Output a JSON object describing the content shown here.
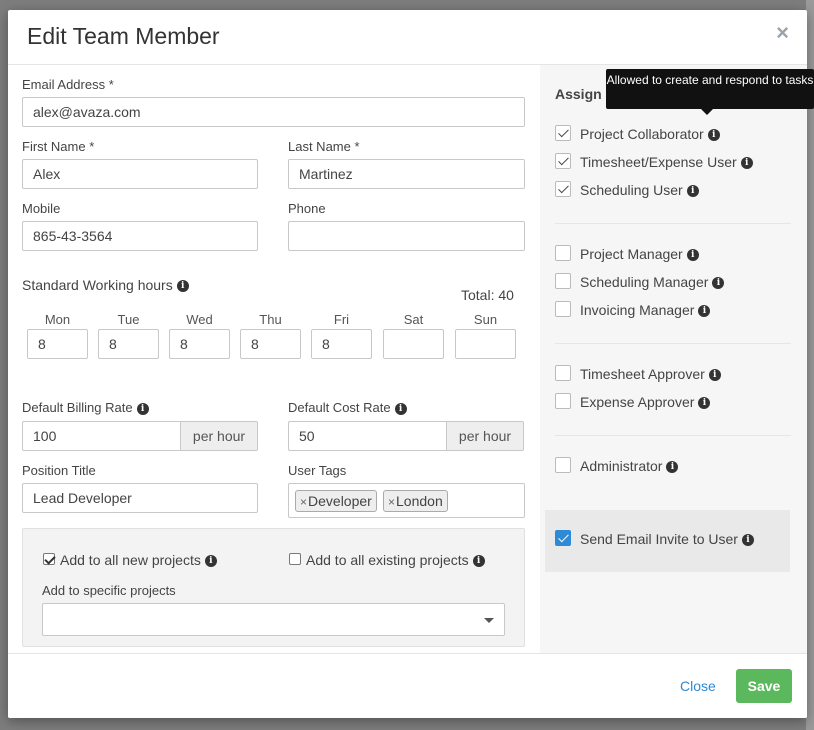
{
  "modal": {
    "title": "Edit Team Member",
    "close_icon": "×"
  },
  "form": {
    "email": {
      "label": "Email Address",
      "required": "*",
      "value": "alex@avaza.com"
    },
    "first_name": {
      "label": "First Name",
      "required": "*",
      "value": "Alex"
    },
    "last_name": {
      "label": "Last Name",
      "required": "*",
      "value": "Martinez"
    },
    "mobile": {
      "label": "Mobile",
      "value": "865-43-3564"
    },
    "phone": {
      "label": "Phone",
      "value": ""
    },
    "working_hours": {
      "label": "Standard Working hours",
      "total": "Total: 40",
      "days": [
        {
          "name": "Mon",
          "value": "8"
        },
        {
          "name": "Tue",
          "value": "8"
        },
        {
          "name": "Wed",
          "value": "8"
        },
        {
          "name": "Thu",
          "value": "8"
        },
        {
          "name": "Fri",
          "value": "8"
        },
        {
          "name": "Sat",
          "value": ""
        },
        {
          "name": "Sun",
          "value": ""
        }
      ]
    },
    "billing_rate": {
      "label": "Default Billing Rate",
      "value": "100",
      "unit": "per hour"
    },
    "cost_rate": {
      "label": "Default Cost Rate",
      "value": "50",
      "unit": "per hour"
    },
    "position_title": {
      "label": "Position Title",
      "value": "Lead Developer"
    },
    "user_tags": {
      "label": "User Tags",
      "remove_glyph": "×",
      "tags": [
        "Developer",
        "London"
      ]
    },
    "projects": {
      "add_new": {
        "label": "Add to all new projects",
        "checked": true
      },
      "add_existing": {
        "label": "Add to all existing projects",
        "checked": false
      },
      "specific_label": "Add to specific projects",
      "specific_value": ""
    }
  },
  "roles": {
    "title": "Assign Roles",
    "tooltip": "Allowed to create and respond to tasks",
    "items": [
      {
        "label": "Project Collaborator",
        "checked": true
      },
      {
        "label": "Timesheet/Expense User",
        "checked": true
      },
      {
        "label": "Scheduling User",
        "checked": true
      },
      {
        "label": "Project Manager",
        "checked": false
      },
      {
        "label": "Scheduling Manager",
        "checked": false
      },
      {
        "label": "Invoicing Manager",
        "checked": false
      },
      {
        "label": "Timesheet Approver",
        "checked": false
      },
      {
        "label": "Expense Approver",
        "checked": false
      },
      {
        "label": "Administrator",
        "checked": false
      }
    ],
    "send_invite": {
      "label": "Send Email Invite to User",
      "checked": true
    }
  },
  "footer": {
    "close_label": "Close",
    "save_label": "Save"
  },
  "info_glyph": "i",
  "colors": {
    "primary": "#2c8ad6",
    "save": "#5cb85c"
  }
}
